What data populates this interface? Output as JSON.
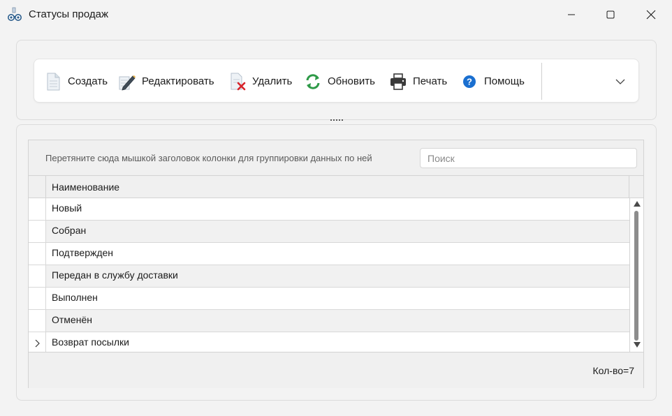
{
  "window": {
    "title": "Статусы продаж",
    "icon": "glasses-icon"
  },
  "toolbar": {
    "create_label": "Создать",
    "edit_label": "Редактировать",
    "delete_label": "Удалить",
    "refresh_label": "Обновить",
    "print_label": "Печать",
    "help_label": "Помощь"
  },
  "grid": {
    "group_hint": "Перетяните сюда мышкой заголовок колонки для группировки данных по ней",
    "search_placeholder": "Поиск",
    "search_value": "",
    "column_header": "Наименование",
    "rows": [
      "Новый",
      "Собран",
      "Подтвержден",
      "Передан в службу доставки",
      "Выполнен",
      "Отменён",
      "Возврат посылки"
    ],
    "current_row_index": 6,
    "count_text": "Кол-во=7"
  },
  "colors": {
    "accent_green": "#2e9a48",
    "help_blue": "#1a6fd0",
    "delete_red": "#d8232a"
  }
}
